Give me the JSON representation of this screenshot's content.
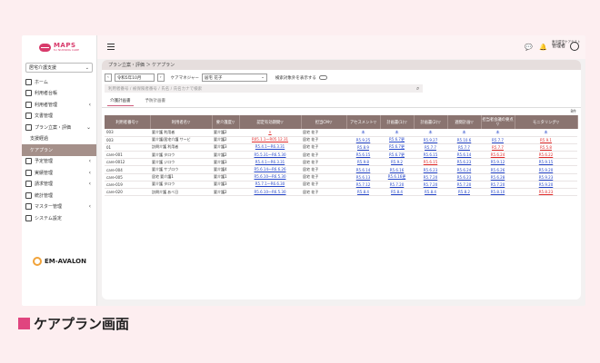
{
  "sidebar": {
    "logo_main": "MAPS",
    "logo_sub": "for NURSING CARE",
    "service_select": "居宅介護支援",
    "items": [
      {
        "label": "ホーム",
        "chevron": ""
      },
      {
        "label": "利用者台帳",
        "chevron": ""
      },
      {
        "label": "利用者管理",
        "chevron": "‹"
      },
      {
        "label": "文書管理",
        "chevron": ""
      },
      {
        "label": "プラン立案・評価",
        "chevron": "⌄"
      },
      {
        "label": "支援経過",
        "chevron": ""
      },
      {
        "label": "ケアプラン",
        "chevron": ""
      },
      {
        "label": "予定管理",
        "chevron": "‹"
      },
      {
        "label": "実績管理",
        "chevron": "‹"
      },
      {
        "label": "請求管理",
        "chevron": "‹"
      },
      {
        "label": "統計管理",
        "chevron": ""
      },
      {
        "label": "マスター管理",
        "chevron": "‹"
      },
      {
        "label": "システム設定",
        "chevron": ""
      }
    ],
    "partner_logo": "EM-AVALON"
  },
  "header": {
    "facility": "東京居宅ケアテスト",
    "user_name": "管理者"
  },
  "breadcrumb": "プラン立案・評価 ＞ ケアプラン",
  "filters": {
    "month": "令和5年10月",
    "manager_label": "ケアマネジャー",
    "manager_value": "居宅 花子",
    "toggle_label": "検索対象外を表示する",
    "search_placeholder": "利用者番号 / 被保険者番号 / 氏名 / 氏名カナで検索"
  },
  "tabs": [
    "介護計画書",
    "予防計画書"
  ],
  "count": "8件",
  "table": {
    "headers": [
      "利用者番号▽",
      "利用者名▽",
      "要介護度▽",
      "認定有効期間▽",
      "担当CM▽",
      "アセスメント▽",
      "計画書(1)▽",
      "計画書(2)▽",
      "週間計画▽",
      "担当者会議の要点▽",
      "モニタリング▽"
    ],
    "rows": [
      {
        "no": "003",
        "name": "要介護 利用者",
        "level": "要介護2",
        "period": "×",
        "cm": "居宅 花子",
        "a": "未",
        "p1": "未",
        "p2": "未",
        "w": "未",
        "m": "未",
        "mo": "未"
      },
      {
        "no": "003",
        "name": "要介護/居宅介護 サービ",
        "level": "要介護2",
        "period": "R05.1.1〜R05.12.31",
        "cm": "居宅 花子",
        "a": "R5.9.25",
        "p1": "R5.6.7更",
        "p2": "R5.9.27",
        "w": "R5.10.6",
        "m": "R5.7.7",
        "mo": "R5.9.1"
      },
      {
        "no": "01",
        "name": "訪問介護 利用者",
        "level": "要介護3",
        "period": "R5.4.1〜R6.3.31",
        "cm": "居宅 花子",
        "a": "R5.8.9",
        "p1": "R5.6.7更",
        "p2": "R5.7.7",
        "w": "R5.7.7",
        "m": "R5.7.7",
        "mo": "R5.5.8"
      },
      {
        "no": "care-001",
        "name": "要介護 タロウ",
        "level": "要介護2",
        "period": "R5.5.31〜R6.5.30",
        "cm": "居宅 花子",
        "a": "R5.6.15",
        "p1": "R5.6.7更",
        "p2": "R5.6.15",
        "w": "R5.6.14",
        "m": "R5.6.24",
        "mo": "R5.6.22"
      },
      {
        "no": "care-0012",
        "name": "要介護 ジロウ",
        "level": "要介護3",
        "period": "R5.4.1〜R6.3.31",
        "cm": "居宅 花子",
        "a": "R5.9.8",
        "p1": "R5.9.2",
        "p2": "R5.6.15",
        "w": "R5.6.23",
        "m": "R5.9.12",
        "mo": "R5.9.15"
      },
      {
        "no": "care-004",
        "name": "要介護 サブロウ",
        "level": "要介護4",
        "period": "R5.6.14〜R6.6.26",
        "cm": "居宅 花子",
        "a": "R5.6.14",
        "p1": "R5.6.16",
        "p2": "R5.6.23",
        "w": "R5.6.24",
        "m": "R5.6.26",
        "mo": "R5.9.20"
      },
      {
        "no": "care-005",
        "name": "居宅 要介護1",
        "level": "要介護1",
        "period": "R5.6.10〜R6.5.30",
        "cm": "居宅 花子",
        "a": "R5.6.13",
        "p1": "R5.6.16更",
        "p2": "R5.7.20",
        "w": "R5.6.23",
        "m": "R5.6.28",
        "mo": "R5.9.23"
      },
      {
        "no": "care-019",
        "name": "要介護 タロウ",
        "level": "要介護3",
        "period": "R5.7.1〜R6.6.30",
        "cm": "居宅 花子",
        "a": "R5.7.12",
        "p1": "R5.7.20",
        "p2": "R5.7.20",
        "w": "R5.7.20",
        "m": "R5.7.20",
        "mo": "R5.9.20"
      },
      {
        "no": "care-020",
        "name": "訪問介護 あべ日",
        "level": "要介護2",
        "period": "R5.6.10〜R6.5.30",
        "cm": "居宅 花子",
        "a": "R5.8.4",
        "p1": "R5.8.4",
        "p2": "R5.8.4",
        "w": "R5.8.2",
        "m": "R5.8.10",
        "mo": "R5.8.23"
      }
    ]
  },
  "caption": "ケアプラン画面",
  "colors": {
    "accent": "#e0457f",
    "table_header": "#8a7470",
    "link": "#2546c9",
    "alert": "#e02b2b"
  }
}
